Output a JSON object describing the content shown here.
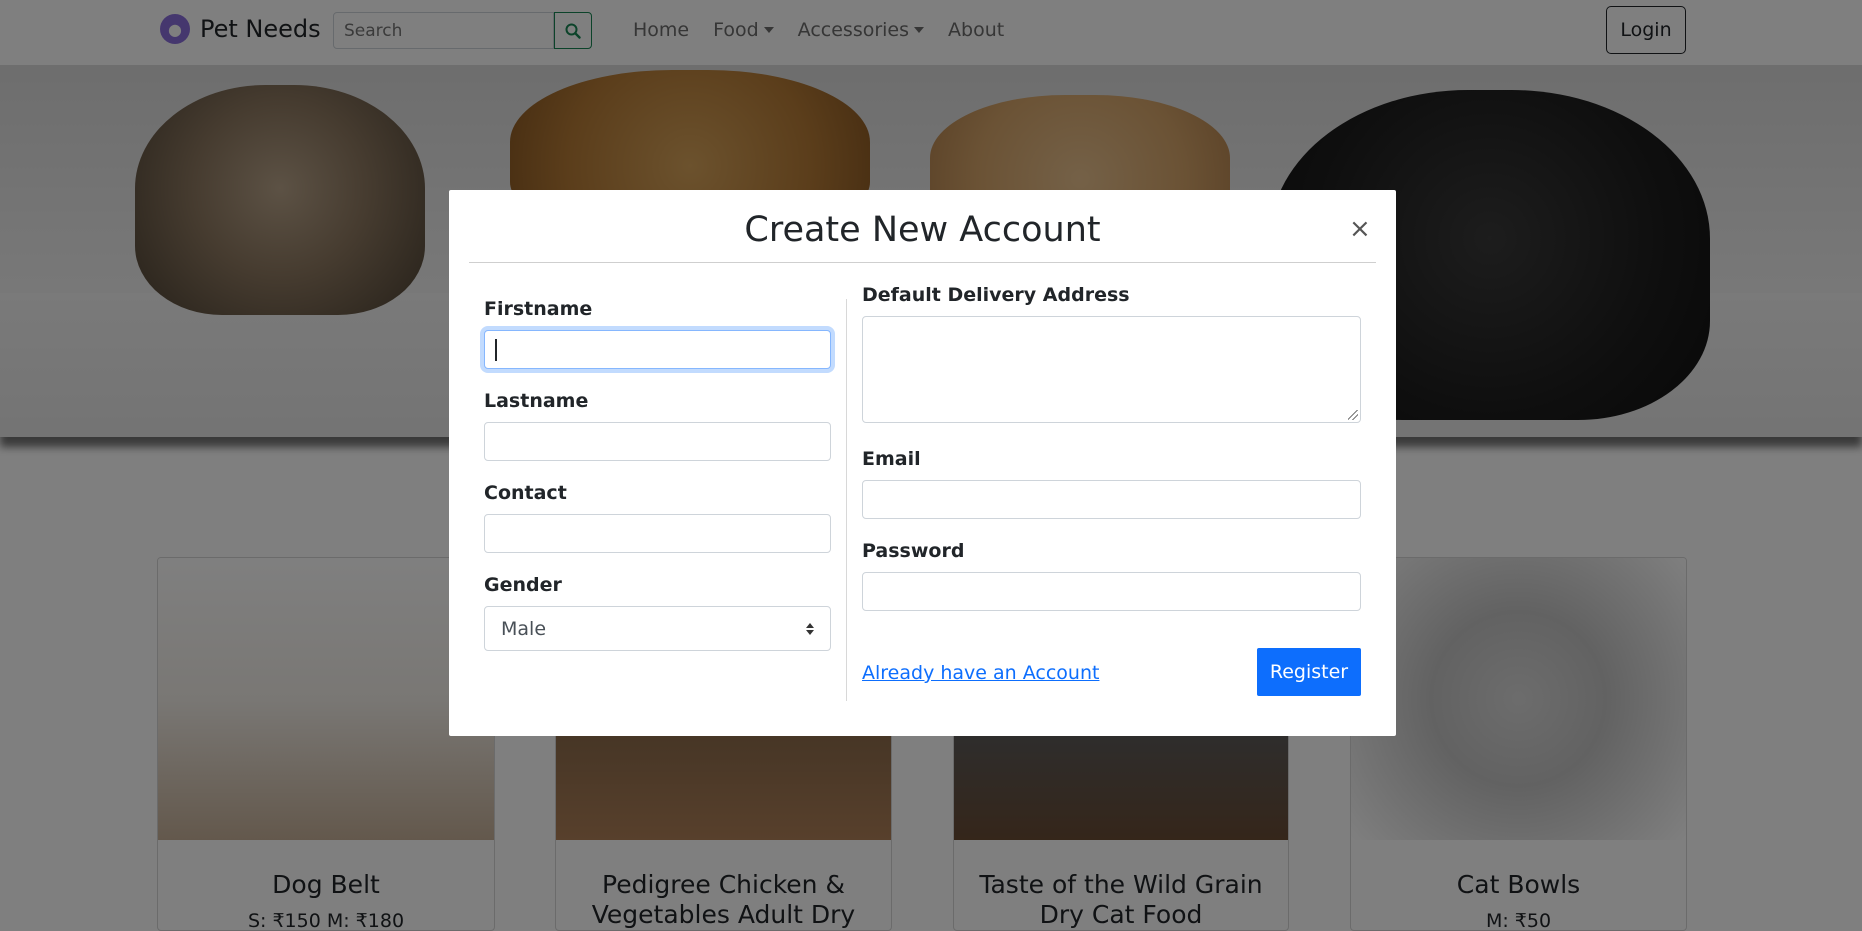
{
  "navbar": {
    "brand": "Pet Needs",
    "search_placeholder": "Search",
    "links": [
      "Home",
      "Food",
      "Accessories",
      "About"
    ],
    "login_label": "Login"
  },
  "products": [
    {
      "title_lines": [
        "Dog Belt"
      ],
      "price": "S: ₹150 M: ₹180"
    },
    {
      "title_lines": [
        "Pedigree Chicken &",
        "Vegetables Adult Dry"
      ],
      "price": ""
    },
    {
      "title_lines": [
        "Taste of the Wild Grain",
        "Dry Cat Food"
      ],
      "price": ""
    },
    {
      "title_lines": [
        "Cat Bowls"
      ],
      "price": "M: ₹50"
    }
  ],
  "modal": {
    "title": "Create New Account",
    "close_symbol": "×",
    "fields": {
      "firstname": {
        "label": "Firstname",
        "value": ""
      },
      "lastname": {
        "label": "Lastname",
        "value": ""
      },
      "contact": {
        "label": "Contact",
        "value": ""
      },
      "gender": {
        "label": "Gender",
        "selected": "Male"
      },
      "address": {
        "label": "Default Delivery Address",
        "value": ""
      },
      "email": {
        "label": "Email",
        "value": ""
      },
      "password": {
        "label": "Password",
        "value": ""
      }
    },
    "login_link": "Already have an Account",
    "register_label": "Register"
  },
  "colors": {
    "primary": "#0d6efd",
    "search_accent": "#198754",
    "backdrop": "rgba(0,0,0,0.5)"
  }
}
